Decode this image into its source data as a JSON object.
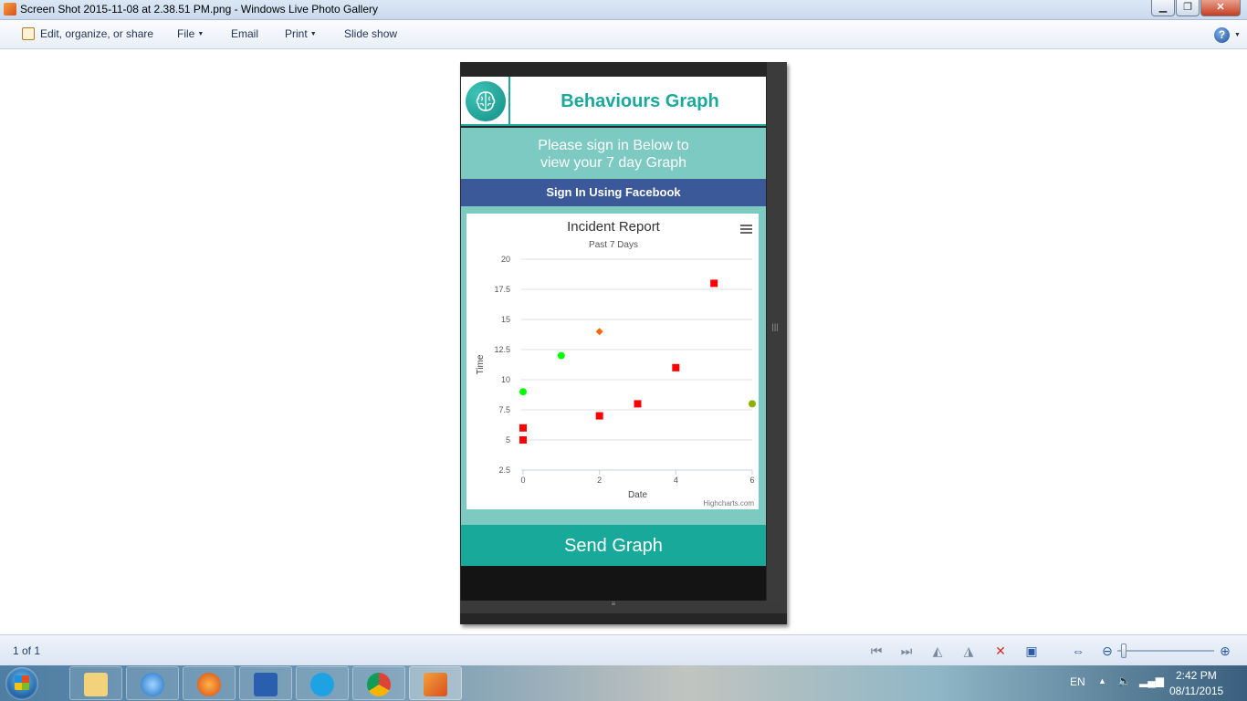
{
  "window": {
    "title": "Screen Shot 2015-11-08 at 2.38.51 PM.png - Windows Live Photo Gallery",
    "minimize": "▁",
    "maximize": "❐",
    "close": "✕"
  },
  "commandbar": {
    "edit_label": "Edit, organize, or share",
    "file_label": "File",
    "email_label": "Email",
    "print_label": "Print",
    "slideshow_label": "Slide show",
    "help_label": "?"
  },
  "app": {
    "title": "Behaviours Graph",
    "signin_line1": "Please sign in Below to",
    "signin_line2": "view your 7 day Graph",
    "facebook_button": "Sign In Using Facebook",
    "send_button": "Send Graph",
    "menu_icon": "hamburger-icon",
    "logo_icon": "brain-icon",
    "accent_color": "#1aa89b",
    "panel_color": "#7ccac2",
    "facebook_color": "#3b5998"
  },
  "chart_data": {
    "type": "scatter",
    "title": "Incident Report",
    "subtitle": "Past 7 Days",
    "xlabel": "Date",
    "ylabel": "Time",
    "credit": "Highcharts.com",
    "xlim": [
      0,
      6
    ],
    "ylim": [
      2.5,
      20
    ],
    "x_ticks": [
      "0",
      "2",
      "4",
      "6"
    ],
    "y_ticks": [
      "2.5",
      "5",
      "7.5",
      "10",
      "12.5",
      "15",
      "17.5",
      "20"
    ],
    "grid": true,
    "series": [
      {
        "color": "#ff0000",
        "marker": "square",
        "points": [
          [
            0,
            5
          ],
          [
            0,
            6
          ],
          [
            2,
            7
          ],
          [
            3,
            8
          ],
          [
            4,
            11
          ],
          [
            5,
            18
          ]
        ]
      },
      {
        "color": "#00ff00",
        "marker": "circle",
        "points": [
          [
            0,
            9
          ],
          [
            1,
            12
          ]
        ]
      },
      {
        "color": "#ff6600",
        "marker": "diamond",
        "points": [
          [
            2,
            14
          ]
        ]
      },
      {
        "color": "#8db000",
        "marker": "circle",
        "points": [
          [
            6,
            8
          ]
        ]
      }
    ]
  },
  "statusbar": {
    "page_count": "1 of 1"
  },
  "taskbar": {
    "language": "EN",
    "time": "2:42 PM",
    "date": "08/11/2015"
  }
}
